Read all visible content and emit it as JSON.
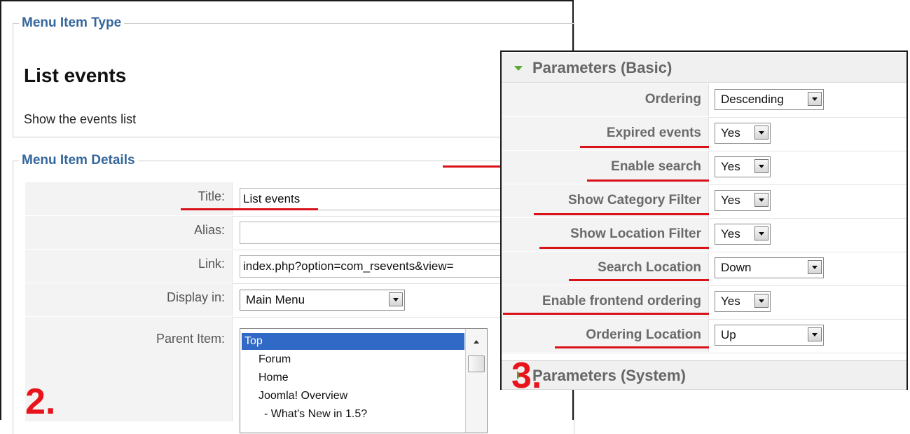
{
  "menu_item_type": {
    "legend": "Menu Item Type",
    "title": "List events",
    "description": "Show the events list"
  },
  "menu_item_details": {
    "legend": "Menu Item Details",
    "title_label": "Title:",
    "title_value": "List events",
    "alias_label": "Alias:",
    "alias_value": "",
    "link_label": "Link:",
    "link_value": "index.php?option=com_rsevents&view=",
    "display_in_label": "Display in:",
    "display_in_value": "Main Menu",
    "parent_item_label": "Parent Item:",
    "parent_items": [
      "Top",
      "Forum",
      "Home",
      "Joomla! Overview",
      "- What's New in 1.5?"
    ],
    "parent_selected": "Top"
  },
  "parameters_basic": {
    "header": "Parameters (Basic)",
    "rows": [
      {
        "label": "Ordering",
        "value": "Descending"
      },
      {
        "label": "Expired events",
        "value": "Yes"
      },
      {
        "label": "Enable search",
        "value": "Yes"
      },
      {
        "label": "Show Category Filter",
        "value": "Yes"
      },
      {
        "label": "Show Location Filter",
        "value": "Yes"
      },
      {
        "label": "Search Location",
        "value": "Down"
      },
      {
        "label": "Enable frontend ordering",
        "value": "Yes"
      },
      {
        "label": "Ordering Location",
        "value": "Up"
      }
    ]
  },
  "parameters_system": {
    "header": "Parameters (System)"
  },
  "step_markers": [
    "2.",
    "3."
  ],
  "colors": {
    "legend_blue": "#35679c",
    "annotation_red": "#d9121a",
    "selection_blue": "#3169c6",
    "toggle_green": "#5aa832"
  }
}
